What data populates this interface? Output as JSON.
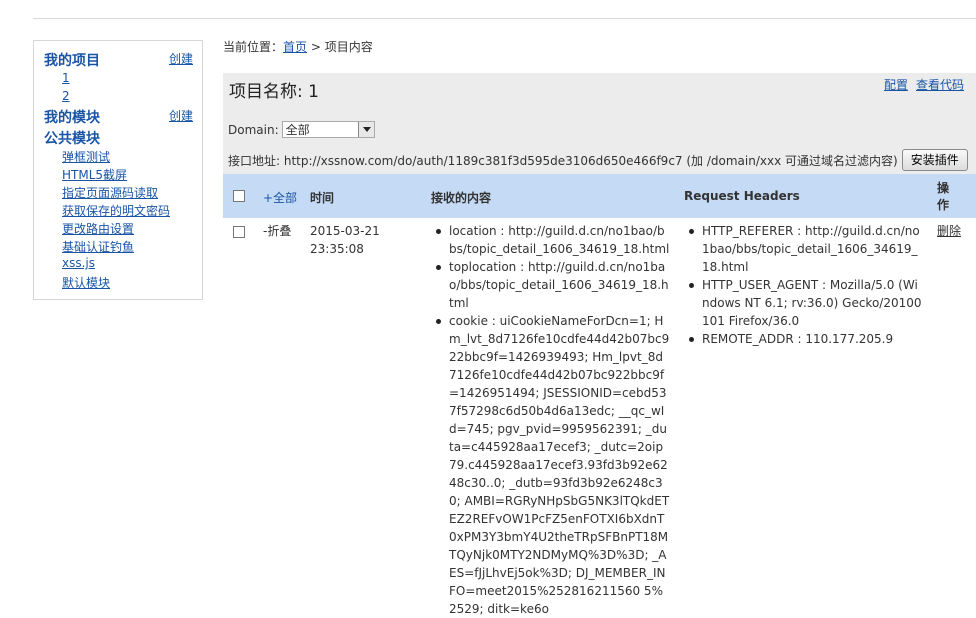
{
  "sidebar": {
    "my_projects": "我的项目",
    "create_project": "创建",
    "projects": [
      "1",
      "2"
    ],
    "my_modules": "我的模块",
    "create_module": "创建",
    "public_modules": "公共模块",
    "modules": [
      "弹框测试",
      "HTML5截屏",
      "指定页面源码读取",
      "获取保存的明文密码",
      "更改路由设置",
      "基础认证钓鱼",
      "xss.js",
      "默认模块"
    ]
  },
  "breadcrumb": {
    "prefix": "当前位置：",
    "home": "首页",
    "separator": " > ",
    "current": "项目内容"
  },
  "project": {
    "title": "项目名称: 1",
    "config_link": "配置",
    "view_code_link": "查看代码",
    "domain_label": "Domain:",
    "domain_value": "全部",
    "api_text": "接口地址: http://xssnow.com/do/auth/1189c381f3d595de3106d650e466f9c7 (加 /domain/xxx 可通过域名过滤内容)",
    "install_button": "安装插件"
  },
  "table": {
    "headers": {
      "expand_all": "+全部",
      "time": "时间",
      "content": "接收的内容",
      "request_headers": "Request Headers",
      "action": "操作"
    },
    "row": {
      "collapse": "-折叠",
      "date": "2015-03-21",
      "clock": "23:35:08",
      "content": [
        "location : http://guild.d.cn/no1bao/bbs/topic_detail_1606_34619_18.html",
        "toplocation : http://guild.d.cn/no1bao/bbs/topic_detail_1606_34619_18.html",
        "cookie : uiCookieNameForDcn=1; Hm_lvt_8d7126fe10cdfe44d42b07bc922bbc9f=1426939493; Hm_lpvt_8d7126fe10cdfe44d42b07bc922bbc9f=1426951494; JSESSIONID=cebd537f57298c6d50b4d6a13edc; __qc_wId=745; pgv_pvid=9959562391; _duta=c445928aa17ecef3; _dutc=2oip79.c445928aa17ecef3.93fd3b92e6248c30..0; _dutb=93fd3b92e6248c30; AMBI=RGRyNHpSbG5NK3lTQkdETEZ2REFvOW1PcFZ5enFOTXI6bXdnT0xPM3Y3bmY4U2theTRpSFBnPT18MTQyNjk0MTY2NDMyMQ%3D%3D; _AES=fJjLhvEj5ok%3D; DJ_MEMBER_INFO=meet2015%252816211560 5%2529; ditk=ke6o"
      ],
      "headers": [
        "HTTP_REFERER : http://guild.d.cn/no1bao/bbs/topic_detail_1606_34619_18.html",
        "HTTP_USER_AGENT : Mozilla/5.0 (Windows NT 6.1; rv:36.0) Gecko/20100101 Firefox/36.0",
        "REMOTE_ADDR : 110.177.205.9"
      ],
      "delete": "删除"
    }
  },
  "colors": {
    "link": "#1a55a5",
    "header_bg": "#c5daf4",
    "panel_bg": "#ececec"
  }
}
